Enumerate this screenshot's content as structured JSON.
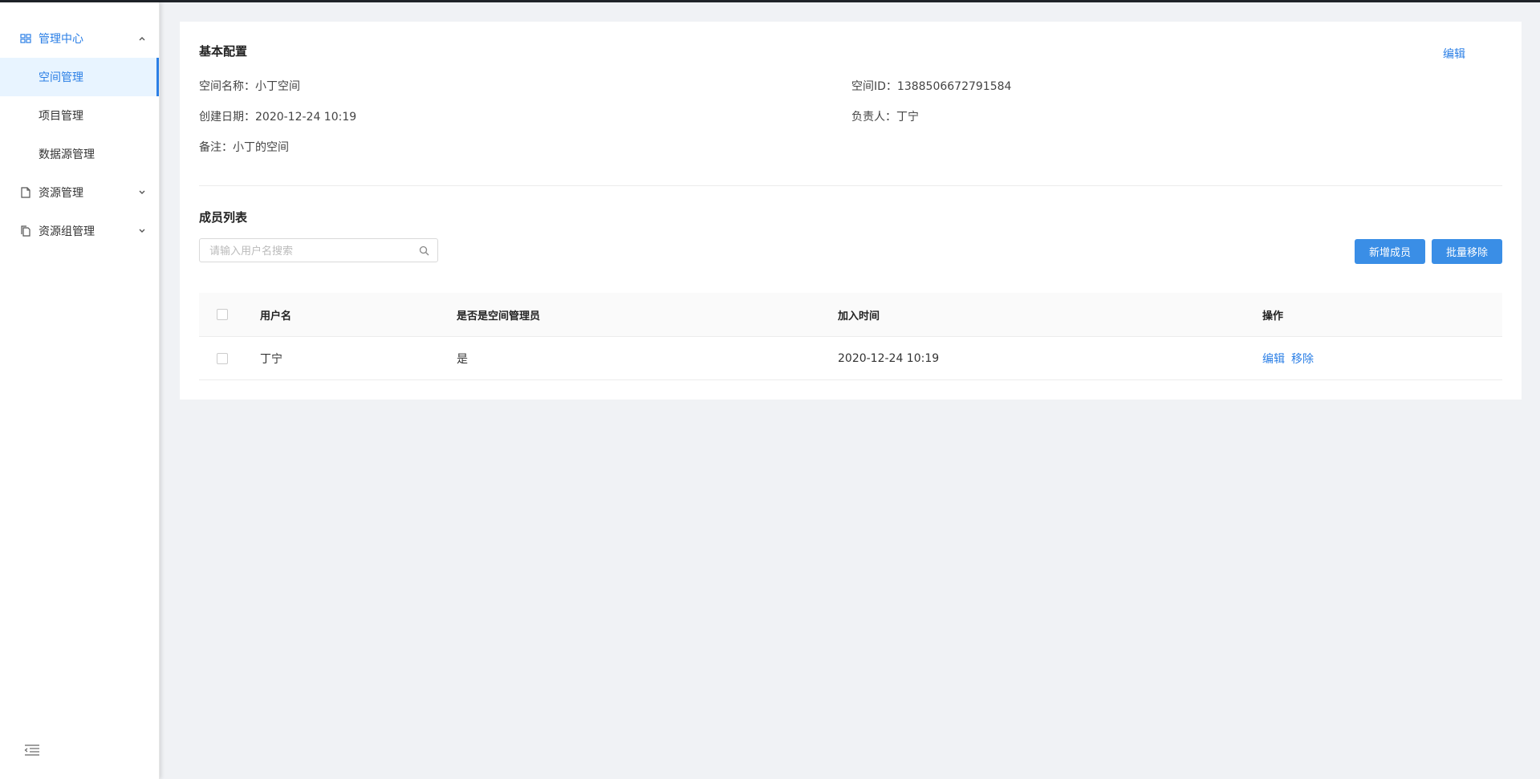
{
  "sidebar": {
    "groups": [
      {
        "label": "管理中心",
        "icon": "grid-icon",
        "expanded": true,
        "items": [
          {
            "label": "空间管理",
            "selected": true
          },
          {
            "label": "项目管理"
          },
          {
            "label": "数据源管理"
          }
        ]
      },
      {
        "label": "资源管理",
        "icon": "file-icon",
        "expanded": false
      },
      {
        "label": "资源组管理",
        "icon": "files-icon",
        "expanded": false
      }
    ],
    "collapse_icon": "menu-fold-icon"
  },
  "basic": {
    "title": "基本配置",
    "edit_label": "编辑",
    "space_name": "空间名称：小丁空间",
    "space_id": "空间ID：1388506672791584",
    "created": "创建日期：2020-12-24 10:19",
    "owner": "负责人：丁宁",
    "remark": "备注：小丁的空间"
  },
  "members": {
    "title": "成员列表",
    "search_placeholder": "请输入用户名搜索",
    "add_button": "新增成员",
    "batch_remove_button": "批量移除",
    "columns": [
      "用户名",
      "是否是空间管理员",
      "加入时间",
      "操作"
    ],
    "rows": [
      {
        "username": "丁宁",
        "is_admin": "是",
        "joined": "2020-12-24 10:19",
        "actions": [
          "编辑",
          "移除"
        ]
      }
    ]
  },
  "colors": {
    "accent": "#2b7fe6",
    "button": "#3a8ee6",
    "background": "#f0f2f5"
  }
}
